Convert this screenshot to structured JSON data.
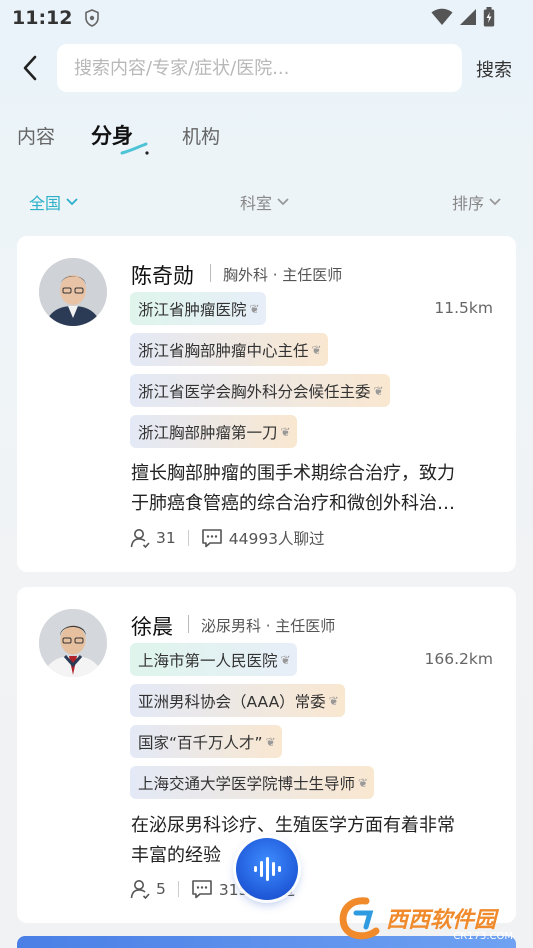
{
  "status_bar": {
    "time": "11:12"
  },
  "search": {
    "placeholder": "搜索内容/专家/症状/医院...",
    "button_label": "搜索"
  },
  "tabs": [
    {
      "label": "内容"
    },
    {
      "label": "分身"
    },
    {
      "label": "机构"
    }
  ],
  "active_tab": "分身",
  "filters": [
    {
      "label": "全国"
    },
    {
      "label": "科室"
    },
    {
      "label": "排序"
    }
  ],
  "doctors": [
    {
      "name": "陈奇勋",
      "dept": "胸外科 · 主任医师",
      "distance": "11.5km",
      "tags": [
        "浙江省肿瘤医院",
        "浙江省胸部肿瘤中心主任",
        "浙江省医学会胸外科分会候任主委",
        "浙江胸部肿瘤第一刀"
      ],
      "desc_line1": "擅长胸部肿瘤的围手术期综合治疗，致力",
      "desc_line2": "于肺癌食管癌的综合治疗和微创外科治…",
      "followers": "31",
      "chats": "44993人聊过"
    },
    {
      "name": "徐晨",
      "dept": "泌尿男科 · 主任医师",
      "distance": "166.2km",
      "tags": [
        "上海市第一人民医院",
        "亚洲男科协会（AAA）常委",
        "国家“百千万人才”",
        "上海交通大学医学院博士生导师"
      ],
      "desc_line1": "在泌尿男科诊疗、生殖医学方面有着非常",
      "desc_line2": "丰富的经验",
      "followers": "5",
      "chats": "315人聊过"
    }
  ],
  "watermark": {
    "text": "西西软件园",
    "sub": "CR173.COM"
  },
  "colors": {
    "accent": "#2bb0c8",
    "voice": "#1f59d8"
  }
}
